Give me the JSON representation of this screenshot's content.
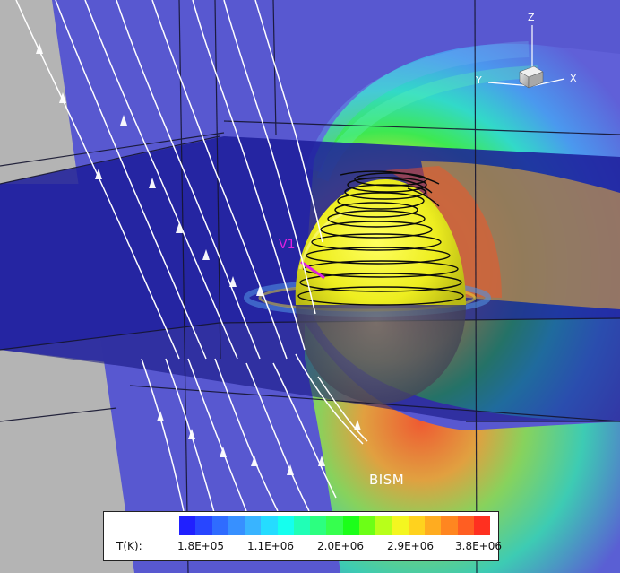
{
  "labels": {
    "trajectory": "V1",
    "region": "BISM"
  },
  "axes": {
    "z": "Z",
    "y": "Y",
    "x": "X"
  },
  "legend": {
    "title": "T(K):",
    "ticks": [
      "1.8E+05",
      "1.1E+06",
      "2.0E+06",
      "2.9E+06",
      "3.8E+06"
    ],
    "colors": [
      "#2020ff",
      "#2846ff",
      "#2f6cff",
      "#3790ff",
      "#39b4ff",
      "#25dcff",
      "#15ffee",
      "#20ffb6",
      "#2cff80",
      "#36ff4e",
      "#1cff1a",
      "#6cff16",
      "#b8ff1a",
      "#f4f620",
      "#ffd21e",
      "#ffac20",
      "#ff8620",
      "#ff5e22",
      "#ff3020"
    ]
  },
  "colors": {
    "sphere": "#f0f028",
    "plane": "#5b5bd4",
    "field_lines": "#ffffff",
    "trajectory": "#e020e0"
  }
}
